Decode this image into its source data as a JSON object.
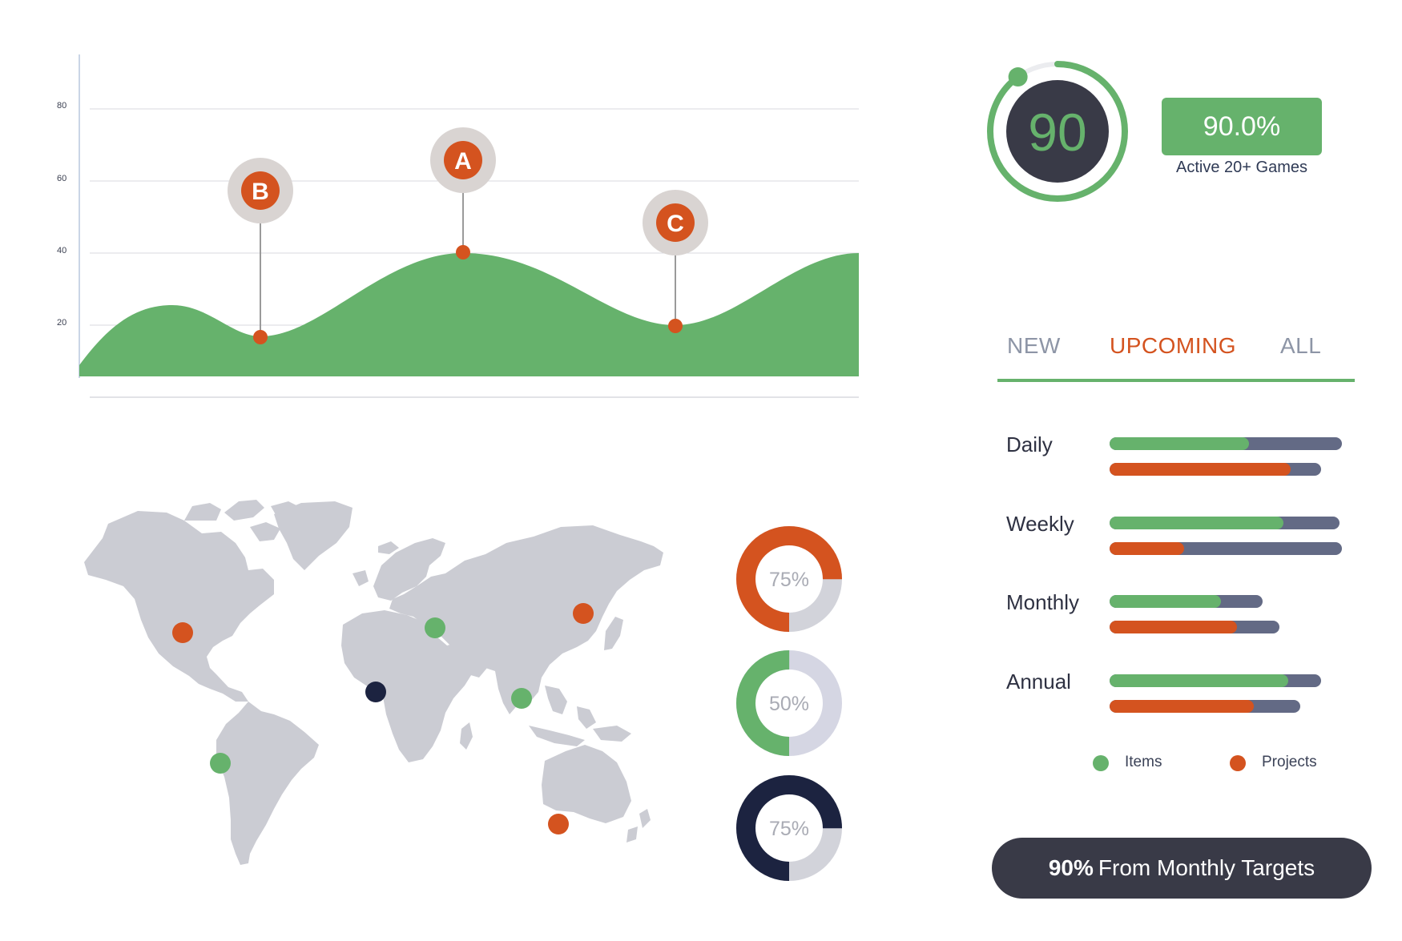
{
  "colors": {
    "green": "#66b26c",
    "orange": "#d4531f",
    "navy": "#1c2340",
    "slate": "#636a85",
    "map_gray": "#cbccd3",
    "ring_track": "#d2d3da"
  },
  "area_chart": {
    "y_ticks": [
      "80",
      "60",
      "40",
      "20"
    ],
    "markers": [
      {
        "label": "B"
      },
      {
        "label": "A"
      },
      {
        "label": "C"
      }
    ]
  },
  "score": {
    "value": "90",
    "progress": 0.9,
    "percent_label": "90.0%",
    "caption": "Active 20+ Games"
  },
  "tabs": {
    "items": [
      "NEW",
      "UPCOMING",
      "ALL"
    ],
    "active": "UPCOMING"
  },
  "bars": {
    "rows": [
      {
        "label": "Daily",
        "items_total": 1.0,
        "items_fill": 0.6,
        "projects_total": 0.91,
        "projects_fill": 0.78
      },
      {
        "label": "Weekly",
        "items_total": 0.99,
        "items_fill": 0.75,
        "projects_total": 1.0,
        "projects_fill": 0.32
      },
      {
        "label": "Monthly",
        "items_total": 0.66,
        "items_fill": 0.48,
        "projects_total": 0.73,
        "projects_fill": 0.55
      },
      {
        "label": "Annual",
        "items_total": 0.91,
        "items_fill": 0.77,
        "projects_total": 0.82,
        "projects_fill": 0.62
      }
    ],
    "legend": {
      "items": "Items",
      "projects": "Projects"
    }
  },
  "donuts": [
    {
      "label": "75%",
      "value": 0.75,
      "color": "orange"
    },
    {
      "label": "50%",
      "value": 0.5,
      "color": "green"
    },
    {
      "label": "75%",
      "value": 0.75,
      "color": "navy"
    }
  ],
  "map": {
    "pins": [
      {
        "name": "north-america",
        "color": "orange"
      },
      {
        "name": "south-america",
        "color": "green"
      },
      {
        "name": "north-africa",
        "color": "navy"
      },
      {
        "name": "eastern-europe",
        "color": "green"
      },
      {
        "name": "siberia",
        "color": "orange"
      },
      {
        "name": "central-asia",
        "color": "green"
      },
      {
        "name": "australia",
        "color": "orange"
      }
    ]
  },
  "footer": {
    "bold": "90%",
    "text": "From Monthly Targets"
  }
}
